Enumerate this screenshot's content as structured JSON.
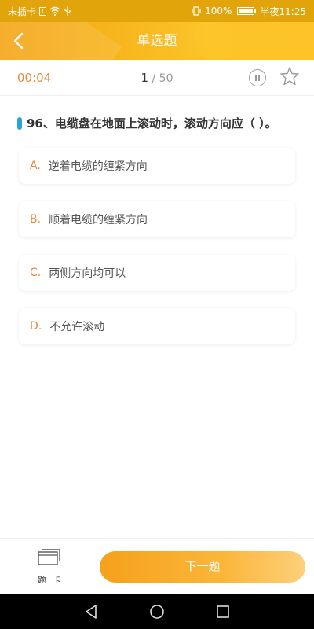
{
  "status_bar": {
    "carrier": "未插卡",
    "battery": "100%",
    "time": "半夜11:25"
  },
  "nav": {
    "title": "单选题"
  },
  "info": {
    "timer": "00:04",
    "current": "1",
    "total": "/ 50"
  },
  "question": {
    "text": "96、电缆盘在地面上滚动时，滚动方向应（ ）。"
  },
  "options": [
    {
      "letter": "A.",
      "text": "逆着电缆的缠紧方向"
    },
    {
      "letter": "B.",
      "text": "顺着电缆的缠紧方向"
    },
    {
      "letter": "C.",
      "text": "两侧方向均可以"
    },
    {
      "letter": "D.",
      "text": "不允许滚动"
    }
  ],
  "bottom": {
    "card_label": "题卡",
    "next_label": "下一题"
  },
  "colors": {
    "accent": "#e8883a",
    "header": "#f7b41c",
    "marker": "#2aa3d8"
  }
}
